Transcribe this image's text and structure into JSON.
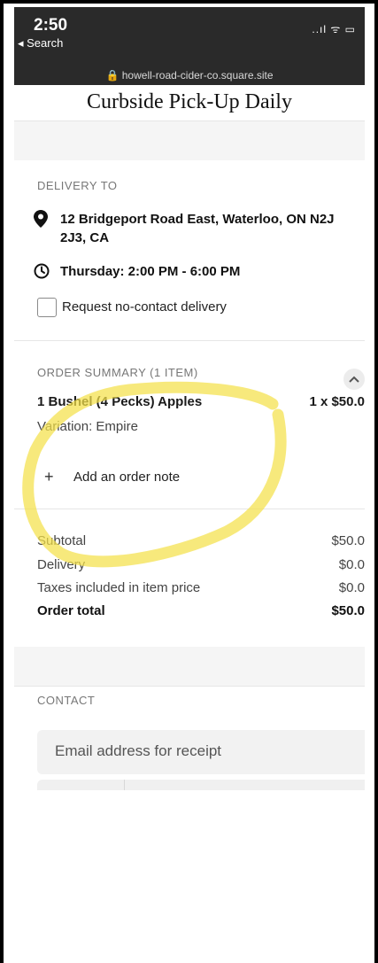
{
  "status_bar": {
    "time": "2:50",
    "back_label": "◂ Search",
    "signal": "..ıl ᯤ ▭"
  },
  "browser": {
    "url": "🔒 howell-road-cider-co.square.site"
  },
  "page": {
    "title": "Curbside Pick-Up Daily"
  },
  "delivery": {
    "heading": "DELIVERY TO",
    "address": "12 Bridgeport Road East, Waterloo, ON N2J 2J3, CA",
    "time": "Thursday: 2:00 PM - 6:00 PM",
    "no_contact_label": "Request no-contact delivery"
  },
  "order": {
    "heading": "ORDER SUMMARY (1 ITEM)",
    "item_name": "1 Bushel (4 Pecks) Apples",
    "item_qty_price": "1 x $50.0",
    "variation": "Variation: Empire",
    "add_note": "Add an order note"
  },
  "totals": {
    "subtotal_label": "Subtotal",
    "subtotal_value": "$50.0",
    "delivery_label": "Delivery",
    "delivery_value": "$0.0",
    "taxes_label": "Taxes included in item price",
    "taxes_value": "$0.0",
    "total_label": "Order total",
    "total_value": "$50.0"
  },
  "contact": {
    "heading": "CONTACT",
    "email_placeholder": "Email address for receipt"
  },
  "colors": {
    "highlight": "#f4e04a",
    "status_bg": "#2a2a2a"
  }
}
